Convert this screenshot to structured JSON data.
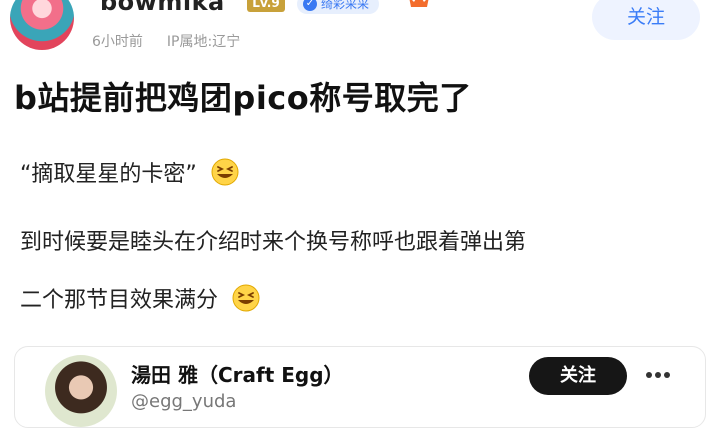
{
  "post": {
    "username": "bowmika",
    "level": "Lv.9",
    "title_badge": "绮彩采采",
    "meta_time": "6小时前",
    "meta_ip": "IP属地:辽宁",
    "follow_label": "关注",
    "title": "b站提前把鸡团pico称号取完了",
    "line1": "“摘取星星的卡密”",
    "line2": "到时候要是睦头在介绍时来个换号称呼也跟着弹出第",
    "line3": "二个那节目效果满分"
  },
  "card": {
    "name": "湯田 雅（Craft Egg）",
    "handle": "@egg_yuda",
    "follow_label": "关注"
  },
  "icons": {
    "emoji": "grinning-squint-emoji",
    "crown": "crown-icon",
    "more": "more-icon",
    "verified": "check-icon"
  },
  "colors": {
    "accent": "#3a7cf7",
    "level_badge": "#c8a13a",
    "card_follow_bg": "#161616",
    "meta_gray": "#9a9a9a"
  }
}
